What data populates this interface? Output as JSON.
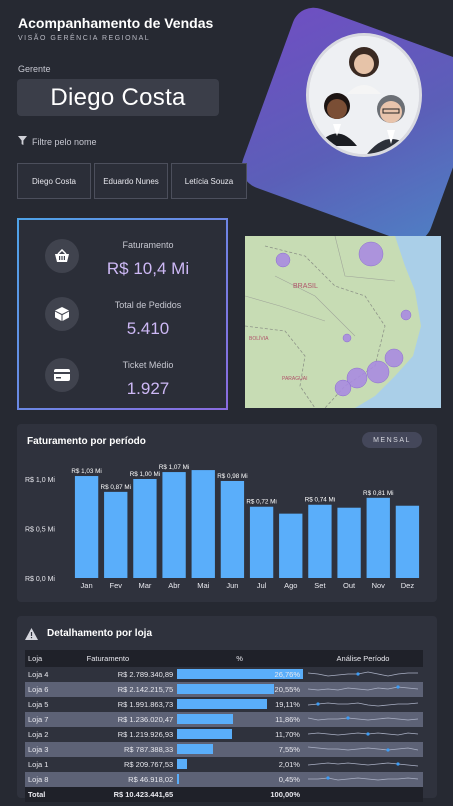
{
  "header": {
    "title": "Acompanhamento de Vendas",
    "subtitle": "VISÃO GERÊNCIA REGIONAL"
  },
  "manager": {
    "label": "Gerente",
    "name": "Diego Costa",
    "filter_label": "Filtre pelo nome",
    "options": [
      "Diego Costa",
      "Eduardo Nunes",
      "Letícia Souza"
    ]
  },
  "kpis": [
    {
      "label": "Faturamento",
      "value": "R$ 10,4 Mi",
      "icon": "basket-icon"
    },
    {
      "label": "Total de Pedidos",
      "value": "5.410",
      "icon": "box-icon"
    },
    {
      "label": "Ticket Médio",
      "value": "1.927",
      "icon": "card-icon"
    }
  ],
  "map": {
    "labels": [
      "BRASIL",
      "BOLÍVIA",
      "PARAGUAI"
    ]
  },
  "chart_panel": {
    "title": "Faturamento por período",
    "toggle_label": "MENSAL"
  },
  "chart_data": {
    "type": "bar",
    "title": "Faturamento por período",
    "categories": [
      "Jan",
      "Fev",
      "Mar",
      "Abr",
      "Mai",
      "Jun",
      "Jul",
      "Ago",
      "Set",
      "Out",
      "Nov",
      "Dez"
    ],
    "values": [
      1.03,
      0.87,
      1.0,
      1.07,
      1.09,
      0.98,
      0.72,
      0.65,
      0.74,
      0.71,
      0.81,
      0.73
    ],
    "data_labels": [
      "R$ 1,03 Mi",
      "R$ 0,87 Mi",
      "R$ 1,00 Mi",
      "R$ 1,07 Mi",
      "",
      "R$ 0,98 Mi",
      "R$ 0,72 Mi",
      "",
      "R$ 0,74 Mi",
      "",
      "R$ 0,81 Mi",
      ""
    ],
    "y_ticks": [
      "R$ 0,0 Mi",
      "R$ 0,5 Mi",
      "R$ 1,0 Mi"
    ],
    "ylim": [
      0,
      1.2
    ],
    "bar_color": "#5aaefa",
    "grid": false
  },
  "table_panel": {
    "title": "Detalhamento por loja",
    "columns": [
      "Loja",
      "Faturamento",
      "%",
      "Análise Período"
    ],
    "rows": [
      {
        "loja": "Loja 4",
        "faturamento": "R$ 2.789.340,89",
        "pct": "26,76%",
        "pct_value": 26.76
      },
      {
        "loja": "Loja 6",
        "faturamento": "R$ 2.142.215,75",
        "pct": "20,55%",
        "pct_value": 20.55
      },
      {
        "loja": "Loja 5",
        "faturamento": "R$ 1.991.863,73",
        "pct": "19,11%",
        "pct_value": 19.11
      },
      {
        "loja": "Loja 7",
        "faturamento": "R$ 1.236.020,47",
        "pct": "11,86%",
        "pct_value": 11.86
      },
      {
        "loja": "Loja 2",
        "faturamento": "R$ 1.219.926,93",
        "pct": "11,70%",
        "pct_value": 11.7
      },
      {
        "loja": "Loja 3",
        "faturamento": "R$ 787.388,33",
        "pct": "7,55%",
        "pct_value": 7.55
      },
      {
        "loja": "Loja 1",
        "faturamento": "R$ 209.767,53",
        "pct": "2,01%",
        "pct_value": 2.01
      },
      {
        "loja": "Loja 8",
        "faturamento": "R$ 46.918,02",
        "pct": "0,45%",
        "pct_value": 0.45
      }
    ],
    "total": {
      "loja": "Total",
      "faturamento": "R$ 10.423.441,65",
      "pct": "100,00%"
    }
  },
  "colors": {
    "background": "#262932",
    "panel": "#2f323d",
    "accent_purple": "#cdb8f5",
    "bar_blue": "#5aaefa",
    "bubble": "#a98be0"
  }
}
